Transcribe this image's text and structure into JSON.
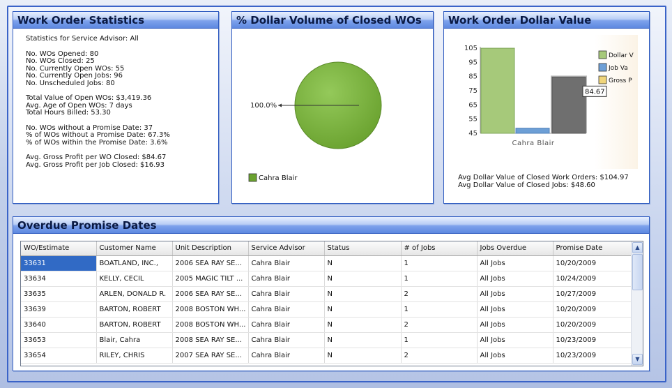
{
  "stats_panel": {
    "title": "Work Order Statistics",
    "lines": [
      "Statistics for Service Advisor: All",
      "",
      "No. WOs Opened: 80",
      "No. WOs Closed: 25",
      "No. Currently Open WOs: 55",
      "No. Currently Open Jobs: 96",
      "No. Unscheduled Jobs: 80",
      "",
      "Total Value of Open WOs: $3,419.36",
      "Avg. Age of Open WOs: 7 days",
      "Total Hours Billed: 53.30",
      "",
      "No. WOs without a Promise Date: 37",
      "% of WOs without a Promise Date: 67.3%",
      "% of WOs within the Promise Date: 3.6%",
      "",
      "Avg. Gross Profit per WO Closed: $84.67",
      "Avg. Gross Profit per Job Closed: $16.93"
    ]
  },
  "pie_panel": {
    "title": "% Dollar Volume of Closed WOs",
    "chart_data": {
      "type": "pie",
      "labels": [
        "Cahra Blair"
      ],
      "values": [
        100.0
      ],
      "slice_labels": [
        "100.0%"
      ],
      "colors": [
        "#6aa22f"
      ],
      "legend": [
        "Cahra Blair"
      ],
      "legend_position": "bottom-left"
    }
  },
  "bar_panel": {
    "title": "Work Order Dollar Value",
    "chart_data": {
      "type": "bar",
      "categories": [
        "Cahra Blair"
      ],
      "series": [
        {
          "name": "Dollar Value",
          "values": [
            104.97
          ],
          "color": "#a6c97a"
        },
        {
          "name": "Job Value",
          "values": [
            48.6
          ],
          "color": "#6d9fd6"
        },
        {
          "name": "Gross Profit",
          "values": [
            84.67
          ],
          "color": "#6f6f6f"
        }
      ],
      "legend_labels": [
        "Dollar V",
        "Job Va",
        "Gross P"
      ],
      "legend_swatch_colors": [
        "#a6c97a",
        "#6d9fd6",
        "#f0d57a"
      ],
      "data_label": "84.67",
      "ylim": [
        45,
        105
      ],
      "yticks": [
        45,
        55,
        65,
        75,
        85,
        95,
        105
      ],
      "legend_position": "right"
    },
    "footer": [
      "Avg Dollar Value of Closed Work Orders: $104.97",
      "Avg Dollar Value of Closed Jobs: $48.60"
    ]
  },
  "table_panel": {
    "title": "Overdue Promise Dates",
    "columns": [
      "WO/Estimate",
      "Customer Name",
      "Unit Description",
      "Service Advisor",
      "Status",
      "# of Jobs",
      "Jobs Overdue",
      "Promise Date"
    ],
    "rows": [
      [
        "33631",
        "BOATLAND, INC.,",
        "2006 SEA RAY SE...",
        "Cahra Blair",
        "N",
        "1",
        "All Jobs",
        "10/20/2009"
      ],
      [
        "33634",
        "KELLY, CECIL",
        "2005 MAGIC TILT ...",
        "Cahra Blair",
        "N",
        "1",
        "All Jobs",
        "10/24/2009"
      ],
      [
        "33635",
        "ARLEN, DONALD R.",
        "2006 SEA RAY SE...",
        "Cahra Blair",
        "N",
        "2",
        "All Jobs",
        "10/27/2009"
      ],
      [
        "33639",
        "BARTON, ROBERT",
        "2008 BOSTON WH...",
        "Cahra Blair",
        "N",
        "1",
        "All Jobs",
        "10/20/2009"
      ],
      [
        "33640",
        "BARTON, ROBERT",
        "2008 BOSTON WH...",
        "Cahra Blair",
        "N",
        "2",
        "All Jobs",
        "10/20/2009"
      ],
      [
        "33653",
        "Blair, Cahra",
        "2008 SEA RAY SE...",
        "Cahra Blair",
        "N",
        "1",
        "All Jobs",
        "10/23/2009"
      ],
      [
        "33654",
        "RILEY, CHRIS",
        "2007 SEA RAY SE...",
        "Cahra Blair",
        "N",
        "2",
        "All Jobs",
        "10/23/2009"
      ]
    ],
    "selected_row": 0
  },
  "scroll_up_icon": "chevron-up-icon",
  "scroll_down_icon": "chevron-down-icon"
}
